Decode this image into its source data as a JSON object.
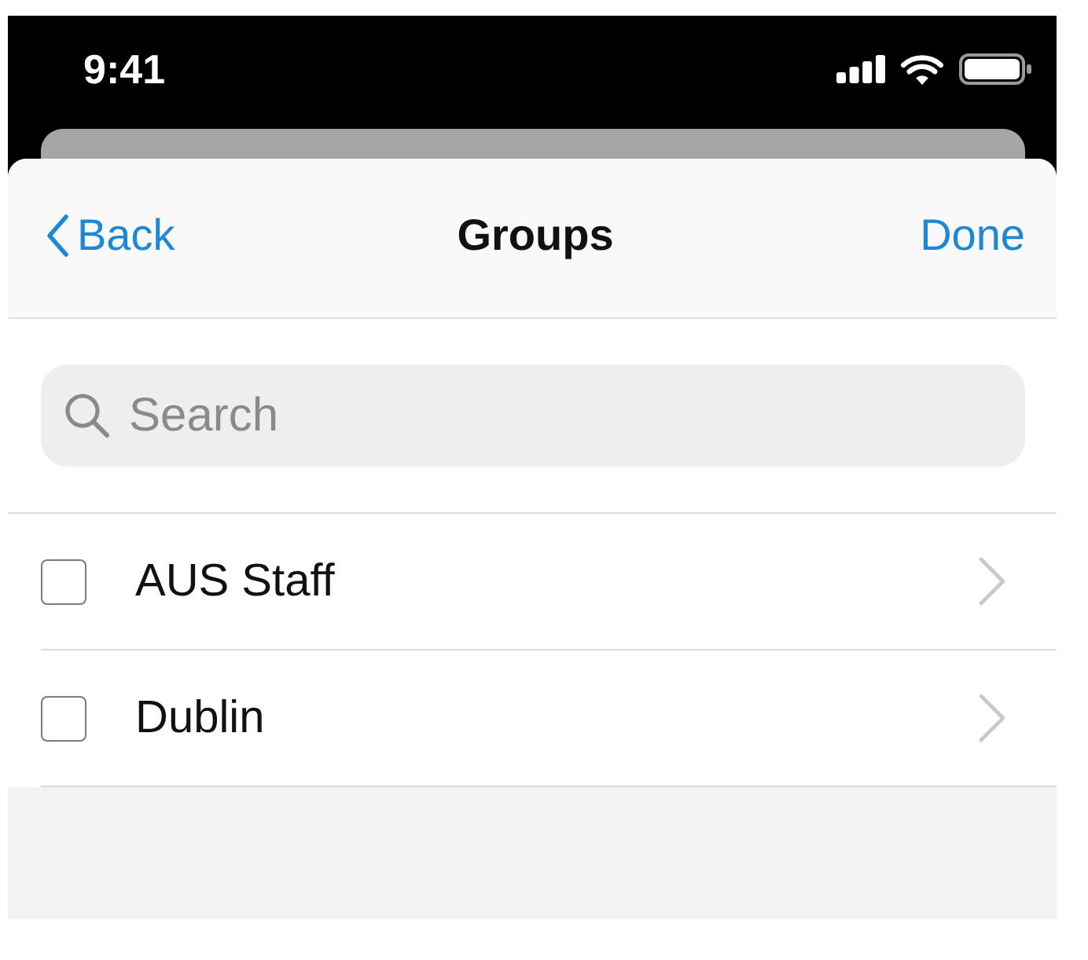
{
  "status_bar": {
    "time": "9:41"
  },
  "nav_bar": {
    "back_button": "Back",
    "title": "Groups",
    "done_button": "Done"
  },
  "search": {
    "placeholder": "Search"
  },
  "groups": [
    {
      "name": "AUS Staff",
      "checked": false
    },
    {
      "name": "Dublin",
      "checked": false
    }
  ]
}
